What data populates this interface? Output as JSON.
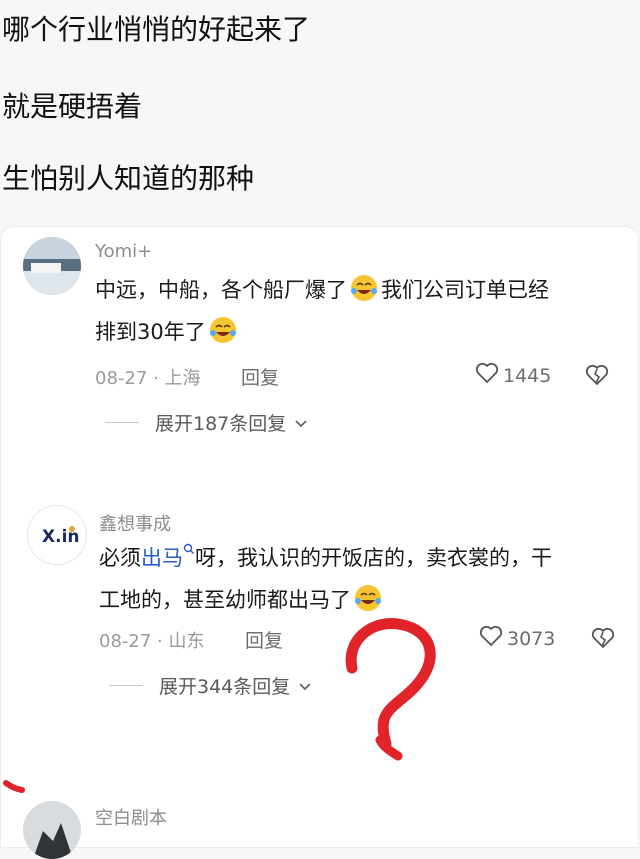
{
  "post": {
    "lines": [
      "哪个行业悄悄的好起来了",
      "就是硬捂着",
      "生怕别人知道的那种"
    ]
  },
  "comments": [
    {
      "username": "Yomi+",
      "text_line1_a": "中远，中船，各个船厂爆了",
      "text_line1_b": "我们公司订单已经",
      "text_line2": "排到30年了",
      "date": "08-27",
      "dot": "·",
      "location": "上海",
      "reply": "回复",
      "likes": "1445",
      "expand": "展开187条回复"
    },
    {
      "username": "鑫想事成",
      "avatar_text": "X.in",
      "text_pre": "必须",
      "text_link": "出马",
      "text_post": "呀，我认识的开饭店的，卖衣裳的，干",
      "text_line2": "工地的，甚至幼师都出马了",
      "date": "08-27",
      "dot": "·",
      "location": "山东",
      "reply": "回复",
      "likes": "3073",
      "expand": "展开344条回复"
    },
    {
      "username": "空白剧本"
    }
  ],
  "colors": {
    "link": "#2a5cc5",
    "scribble": "#e0242a",
    "emoji_face": "#f7c531"
  },
  "icons": [
    "heart-outline-icon",
    "broken-heart-icon",
    "chevron-down-icon",
    "search-mini-icon",
    "laughing-crying-emoji"
  ]
}
